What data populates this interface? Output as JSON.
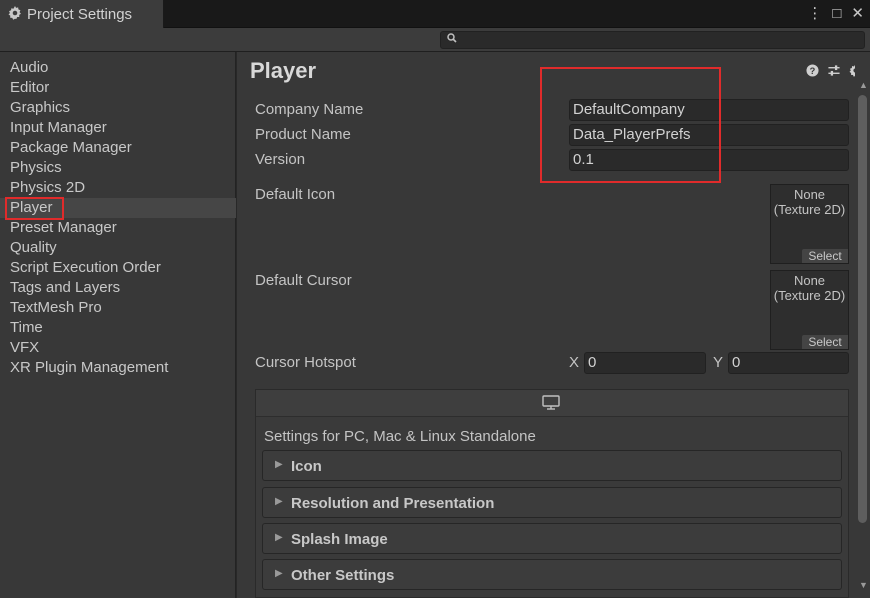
{
  "window": {
    "tab_title": "Project Settings",
    "controls": {
      "menu": "⋮",
      "maximize": "□",
      "close": "✕"
    }
  },
  "search": {
    "placeholder": "",
    "icon": "search-icon"
  },
  "sidebar": {
    "items": [
      {
        "label": "Audio"
      },
      {
        "label": "Editor"
      },
      {
        "label": "Graphics"
      },
      {
        "label": "Input Manager"
      },
      {
        "label": "Package Manager"
      },
      {
        "label": "Physics"
      },
      {
        "label": "Physics 2D"
      },
      {
        "label": "Player",
        "selected": true
      },
      {
        "label": "Preset Manager"
      },
      {
        "label": "Quality"
      },
      {
        "label": "Script Execution Order"
      },
      {
        "label": "Tags and Layers"
      },
      {
        "label": "TextMesh Pro"
      },
      {
        "label": "Time"
      },
      {
        "label": "VFX"
      },
      {
        "label": "XR Plugin Management"
      }
    ]
  },
  "main": {
    "title": "Player",
    "header_icons": [
      "help-icon",
      "presets-icon",
      "gear-icon"
    ],
    "company_name": {
      "label": "Company Name",
      "value": "DefaultCompany"
    },
    "product_name": {
      "label": "Product Name",
      "value": "Data_PlayerPrefs"
    },
    "version": {
      "label": "Version",
      "value": "0.1"
    },
    "default_icon": {
      "label": "Default Icon",
      "slot_text_1": "None",
      "slot_text_2": "(Texture 2D)",
      "select": "Select"
    },
    "default_cursor": {
      "label": "Default Cursor",
      "slot_text_1": "None",
      "slot_text_2": "(Texture 2D)",
      "select": "Select"
    },
    "cursor_hotspot": {
      "label": "Cursor Hotspot",
      "x_label": "X",
      "x_value": "0",
      "y_label": "Y",
      "y_value": "0"
    },
    "platform": {
      "caption": "Settings for PC, Mac & Linux Standalone",
      "foldouts": [
        {
          "label": "Icon"
        },
        {
          "label": "Resolution and Presentation"
        },
        {
          "label": "Splash Image"
        },
        {
          "label": "Other Settings"
        }
      ]
    }
  },
  "colors": {
    "highlight_box": "#e02b2b",
    "background": "#383838",
    "field_bg": "#2a2a2a"
  }
}
